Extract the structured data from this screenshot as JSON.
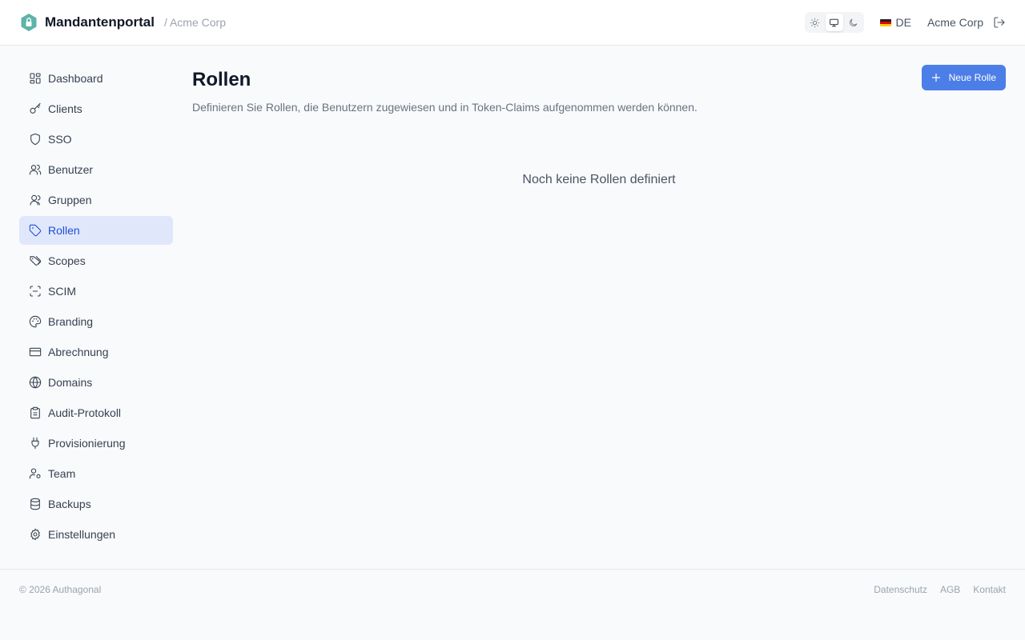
{
  "header": {
    "title": "Mandantenportal",
    "tenant_crumb": "/ Acme Corp",
    "language": "DE",
    "tenant_name": "Acme Corp"
  },
  "sidebar": {
    "items": [
      {
        "label": "Dashboard",
        "icon": "dashboard-icon"
      },
      {
        "label": "Clients",
        "icon": "key-icon"
      },
      {
        "label": "SSO",
        "icon": "shield-icon"
      },
      {
        "label": "Benutzer",
        "icon": "users-icon"
      },
      {
        "label": "Gruppen",
        "icon": "group-icon"
      },
      {
        "label": "Rollen",
        "icon": "tag-icon"
      },
      {
        "label": "Scopes",
        "icon": "tags-icon"
      },
      {
        "label": "SCIM",
        "icon": "scan-icon"
      },
      {
        "label": "Branding",
        "icon": "palette-icon"
      },
      {
        "label": "Abrechnung",
        "icon": "credit-card-icon"
      },
      {
        "label": "Domains",
        "icon": "globe-icon"
      },
      {
        "label": "Audit-Protokoll",
        "icon": "clipboard-icon"
      },
      {
        "label": "Provisionierung",
        "icon": "plug-icon"
      },
      {
        "label": "Team",
        "icon": "user-cog-icon"
      },
      {
        "label": "Backups",
        "icon": "database-icon"
      },
      {
        "label": "Einstellungen",
        "icon": "gear-icon"
      }
    ],
    "active": "Rollen"
  },
  "main": {
    "title": "Rollen",
    "description": "Definieren Sie Rollen, die Benutzern zugewiesen und in Token-Claims aufgenommen werden können.",
    "new_button": "Neue Rolle",
    "empty_state": "Noch keine Rollen definiert"
  },
  "footer": {
    "copyright": "© 2026 Authagonal",
    "links": [
      "Datenschutz",
      "AGB",
      "Kontakt"
    ]
  },
  "colors": {
    "accent": "#4c7ee8",
    "active_bg": "#e0e7fb",
    "active_text": "#1d4ed8",
    "logo": "#5fb3a8"
  }
}
